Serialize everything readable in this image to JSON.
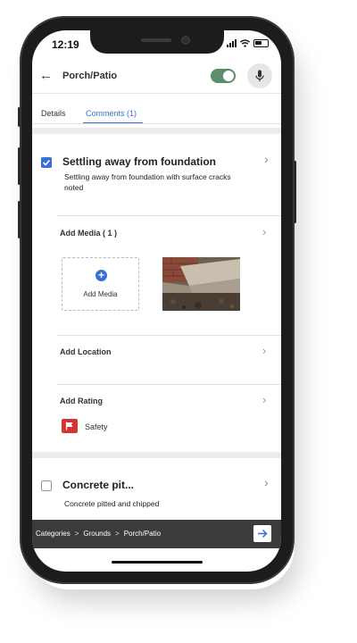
{
  "status_bar": {
    "time": "12:19"
  },
  "header": {
    "back_icon": "arrow-left-icon",
    "title": "Porch/Patio",
    "toggle_on": true,
    "toggle_color": "#5a8f6b",
    "mic_icon": "microphone-icon"
  },
  "tabs": [
    {
      "label": "Details",
      "active": false
    },
    {
      "label": "Comments (1)",
      "active": true
    }
  ],
  "accent_color": "#3a6fd8",
  "comments": [
    {
      "checked": true,
      "title": "Settling away from foundation",
      "body": "Settling away from foundation with surface cracks noted",
      "add_media_label": "Add Media ( 1 )",
      "add_media_button": "Add Media",
      "add_location_label": "Add Location",
      "add_rating_label": "Add Rating",
      "rating": {
        "label": "Safety",
        "icon": "flag-icon",
        "color": "#d63333"
      }
    },
    {
      "checked": false,
      "title": "Concrete pit...",
      "body": "Concrete pitted and chipped"
    }
  ],
  "breadcrumb": {
    "items": [
      "Categories",
      "Grounds",
      "Porch/Patio"
    ],
    "separator": ">",
    "next_icon": "arrow-right-icon"
  }
}
